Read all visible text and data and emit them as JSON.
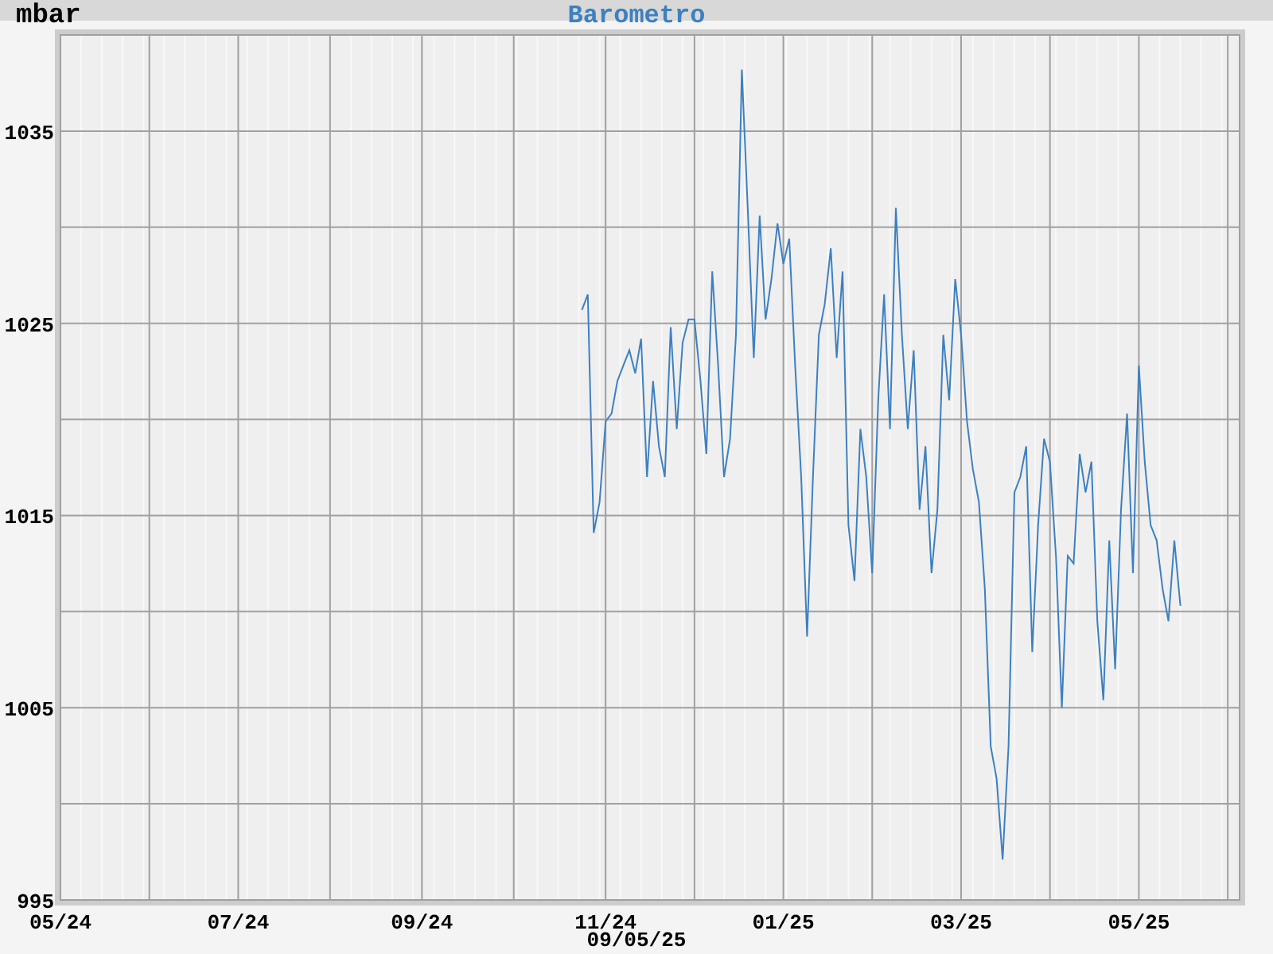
{
  "chart_data": {
    "type": "line",
    "title": "Barometro",
    "ylabel": "mbar",
    "ylim": [
      995,
      1040
    ],
    "grid": true,
    "yticks": [
      995,
      1005,
      1015,
      1025,
      1035
    ],
    "categories": [
      "05/24",
      null,
      null,
      null,
      null,
      null,
      null,
      null,
      null,
      null,
      null,
      null,
      null,
      null,
      null,
      null,
      null,
      null,
      null,
      null,
      null,
      null,
      null,
      null,
      null,
      null,
      null,
      null,
      null,
      null,
      "07/24",
      null,
      null,
      null,
      null,
      null,
      null,
      null,
      null,
      null,
      null,
      null,
      null,
      null,
      null,
      null,
      null,
      null,
      null,
      null,
      null,
      null,
      null,
      null,
      null,
      null,
      null,
      null,
      null,
      null,
      null,
      "09/24",
      null,
      null,
      null,
      null,
      null,
      null,
      null,
      null,
      null,
      null,
      null,
      null,
      null,
      null,
      null,
      null,
      null,
      null,
      null,
      null,
      null,
      null,
      null,
      null,
      null,
      null,
      null,
      null,
      null,
      null,
      "11/24",
      null,
      null,
      null,
      null,
      null,
      null,
      null,
      null,
      null,
      null,
      null,
      null,
      null,
      null,
      null,
      null,
      null,
      null,
      null,
      null,
      null,
      null,
      null,
      null,
      null,
      null,
      null,
      null,
      null,
      "01/25",
      null,
      null,
      null,
      null,
      null,
      null,
      null,
      null,
      null,
      null,
      null,
      null,
      null,
      null,
      null,
      null,
      null,
      null,
      null,
      null,
      null,
      null,
      null,
      null,
      null,
      null,
      null,
      null,
      null,
      "03/25",
      null,
      null,
      null,
      null,
      null,
      null,
      null,
      null,
      null,
      null,
      null,
      null,
      null,
      null,
      null,
      null,
      null,
      null,
      null,
      null,
      null,
      null,
      null,
      null,
      null,
      null,
      null,
      null,
      null,
      "05/25",
      null,
      null,
      null,
      null,
      null,
      null,
      null,
      null,
      null,
      null,
      null,
      null,
      null,
      null,
      null,
      null
    ],
    "series": [
      {
        "color": "#3d80c0",
        "values": [
          null,
          null,
          null,
          null,
          null,
          null,
          null,
          null,
          null,
          null,
          null,
          null,
          null,
          null,
          null,
          null,
          null,
          null,
          null,
          null,
          null,
          null,
          null,
          null,
          null,
          null,
          null,
          null,
          null,
          null,
          null,
          null,
          null,
          null,
          null,
          null,
          null,
          null,
          null,
          null,
          null,
          null,
          null,
          null,
          null,
          null,
          null,
          null,
          null,
          null,
          null,
          null,
          null,
          null,
          null,
          null,
          null,
          null,
          null,
          null,
          null,
          null,
          null,
          null,
          null,
          null,
          null,
          null,
          null,
          null,
          null,
          null,
          null,
          null,
          null,
          null,
          null,
          null,
          null,
          null,
          null,
          null,
          null,
          null,
          null,
          null,
          null,
          null,
          1025.7,
          1026.5,
          1014.1,
          1015.7,
          1019.9,
          1020.3,
          1022,
          1022.8,
          1023.6,
          1022.4,
          1024.2,
          1017,
          1022,
          1018.6,
          1017,
          1024.8,
          1019.5,
          1024,
          1025.2,
          1025.2,
          1022,
          1018.2,
          1027.7,
          1022.8,
          1017,
          1019,
          1024.4,
          1038.2,
          1031,
          1023.2,
          1030.6,
          1025.2,
          1027.3,
          1030.2,
          1028.1,
          1029.4,
          1022.8,
          1017,
          1008.7,
          1017,
          1024.4,
          1026,
          1028.9,
          1023.2,
          1027.7,
          1014.5,
          1011.6,
          1019.5,
          1017,
          1012,
          1021,
          1026.5,
          1019.5,
          1031,
          1024.4,
          1019.5,
          1023.6,
          1015.3,
          1018.6,
          1012,
          1015.3,
          1024.4,
          1021,
          1027.3,
          1024.4,
          1019.9,
          1017.4,
          1015.7,
          1011.2,
          1003,
          1001.3,
          997.1,
          1003,
          1016.2,
          1017,
          1018.6,
          1007.9,
          1014.5,
          1019,
          1017.8,
          1012.9,
          1005,
          1012.9,
          1012.5,
          1018.2,
          1016.2,
          1017.8,
          1009.5,
          1005.4,
          1013.7,
          1007,
          1015.3,
          1020.3,
          1012,
          1022.8,
          1017.8,
          1014.5,
          1013.7,
          1011.2,
          1009.5,
          1013.7,
          1010.3,
          null,
          null,
          null,
          null,
          null,
          null,
          null,
          null,
          null
        ]
      }
    ]
  },
  "date": "09/05/25"
}
